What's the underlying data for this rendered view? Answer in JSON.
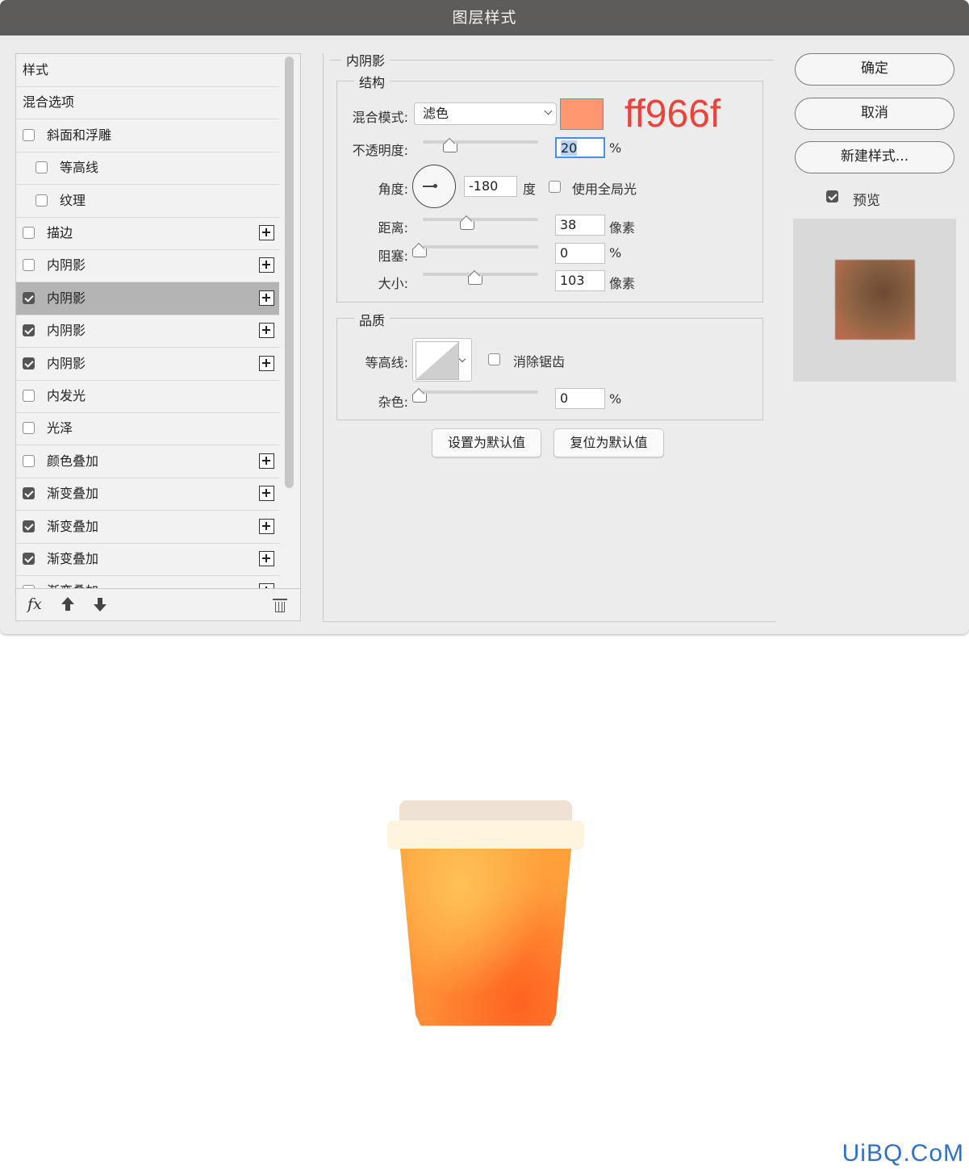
{
  "window": {
    "title": "图层样式"
  },
  "styles_list": {
    "items": [
      {
        "label": "样式",
        "checkbox": null,
        "indent": 0,
        "plus": false,
        "selected": false
      },
      {
        "label": "混合选项",
        "checkbox": null,
        "indent": 0,
        "plus": false,
        "selected": false
      },
      {
        "label": "斜面和浮雕",
        "checkbox": false,
        "indent": 0,
        "plus": false,
        "selected": false
      },
      {
        "label": "等高线",
        "checkbox": false,
        "indent": 1,
        "plus": false,
        "selected": false
      },
      {
        "label": "纹理",
        "checkbox": false,
        "indent": 1,
        "plus": false,
        "selected": false
      },
      {
        "label": "描边",
        "checkbox": false,
        "indent": 0,
        "plus": true,
        "selected": false
      },
      {
        "label": "内阴影",
        "checkbox": false,
        "indent": 0,
        "plus": true,
        "selected": false
      },
      {
        "label": "内阴影",
        "checkbox": true,
        "indent": 0,
        "plus": true,
        "selected": true
      },
      {
        "label": "内阴影",
        "checkbox": true,
        "indent": 0,
        "plus": true,
        "selected": false
      },
      {
        "label": "内阴影",
        "checkbox": true,
        "indent": 0,
        "plus": true,
        "selected": false
      },
      {
        "label": "内发光",
        "checkbox": false,
        "indent": 0,
        "plus": false,
        "selected": false
      },
      {
        "label": "光泽",
        "checkbox": false,
        "indent": 0,
        "plus": false,
        "selected": false
      },
      {
        "label": "颜色叠加",
        "checkbox": false,
        "indent": 0,
        "plus": true,
        "selected": false
      },
      {
        "label": "渐变叠加",
        "checkbox": true,
        "indent": 0,
        "plus": true,
        "selected": false
      },
      {
        "label": "渐变叠加",
        "checkbox": true,
        "indent": 0,
        "plus": true,
        "selected": false
      },
      {
        "label": "渐变叠加",
        "checkbox": true,
        "indent": 0,
        "plus": true,
        "selected": false
      },
      {
        "label": "渐变叠加",
        "checkbox": false,
        "indent": 0,
        "plus": true,
        "selected": false
      }
    ],
    "footer": {
      "fx_label": "fx"
    }
  },
  "inner_shadow": {
    "section_title": "内阴影",
    "structure": {
      "title": "结构",
      "blend_mode_label": "混合模式:",
      "blend_mode_value": "滤色",
      "color": "#ff966f",
      "color_note": "ff966f",
      "opacity_label": "不透明度:",
      "opacity_value": "20",
      "opacity_unit": "%",
      "opacity_slider": 0.2,
      "angle_label": "角度:",
      "angle_value": "-180",
      "angle_unit": "度",
      "global_light_label": "使用全局光",
      "global_light_checked": false,
      "distance_label": "距离:",
      "distance_value": "38",
      "distance_unit": "像素",
      "choke_label": "阻塞:",
      "choke_value": "0",
      "choke_unit": "%",
      "size_label": "大小:",
      "size_value": "103",
      "size_unit": "像素"
    },
    "quality": {
      "title": "品质",
      "contour_label": "等高线:",
      "anti_alias_label": "消除锯齿",
      "anti_alias_checked": false,
      "noise_label": "杂色:",
      "noise_value": "0",
      "noise_unit": "%"
    },
    "set_default_label": "设置为默认值",
    "reset_default_label": "复位为默认值"
  },
  "actions": {
    "ok_label": "确定",
    "cancel_label": "取消",
    "new_style_label": "新建样式...",
    "preview_label": "预览",
    "preview_checked": true
  },
  "watermark": "UiBQ.CoM"
}
